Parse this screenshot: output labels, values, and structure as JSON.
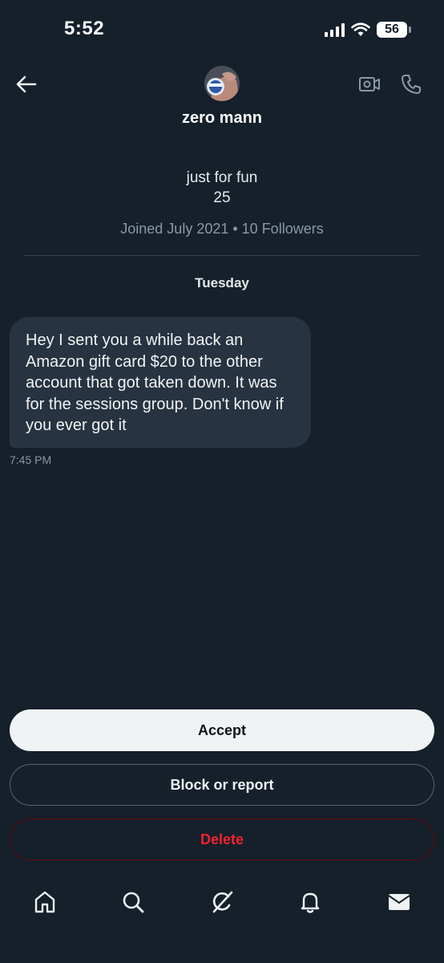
{
  "status_bar": {
    "time": "5:52",
    "battery": "56"
  },
  "header": {
    "display_name": "zero mann",
    "back_icon": "arrow-left-icon",
    "video_icon": "video-camera-icon",
    "phone_icon": "phone-icon"
  },
  "profile": {
    "bio_line1": "just for fun",
    "bio_line2": "25",
    "joined": "Joined July 2021 • 10 Followers"
  },
  "conversation": {
    "day_label": "Tuesday",
    "messages": [
      {
        "text": "Hey I sent you a while back an Amazon gift card $20 to the other account that got taken down. It was for the sessions group. Don't know if you ever got it",
        "time": "7:45 PM"
      }
    ]
  },
  "actions": {
    "accept_label": "Accept",
    "block_label": "Block or report",
    "delete_label": "Delete"
  },
  "nav": {
    "items": [
      "home-icon",
      "search-icon",
      "grok-icon",
      "notifications-icon",
      "messages-icon"
    ]
  },
  "colors": {
    "background": "#15202b",
    "bubble": "#273340",
    "accept_bg": "#eff3f4",
    "delete_red": "#f4212e",
    "muted_text": "#8b98a5"
  }
}
